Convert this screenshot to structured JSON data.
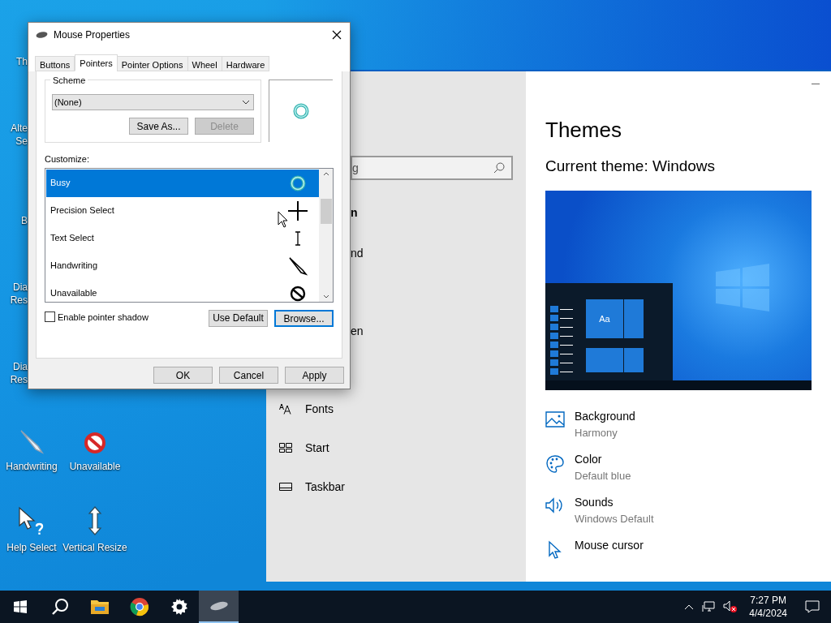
{
  "desktop": {
    "icons_partial": [
      {
        "lines": [
          "Th"
        ]
      },
      {
        "lines": [
          "Alte",
          "Se"
        ]
      },
      {
        "lines": [
          "B"
        ]
      },
      {
        "lines": [
          "Dia",
          "Res"
        ]
      },
      {
        "lines": [
          "Dia",
          "Res"
        ]
      }
    ],
    "icons": [
      {
        "label": "Handwriting",
        "kind": "pen"
      },
      {
        "label": "Unavailable",
        "kind": "no"
      },
      {
        "label": "Help Select",
        "kind": "help"
      },
      {
        "label": "Vertical Resize",
        "kind": "vresize"
      }
    ]
  },
  "settings_window": {
    "search": {
      "value": "g"
    },
    "nav": [
      {
        "label": "n",
        "kind": "header"
      },
      {
        "label": "nd",
        "kind": "partial"
      },
      {
        "label": "en",
        "kind": "partial"
      },
      {
        "label": "Fonts",
        "kind": "fonts"
      },
      {
        "label": "Start",
        "kind": "start"
      },
      {
        "label": "Taskbar",
        "kind": "taskbar"
      }
    ],
    "title": "Themes",
    "current_theme": "Current theme: Windows",
    "preview_tile": "Aa",
    "options": [
      {
        "title": "Background",
        "value": "Harmony",
        "kind": "picture"
      },
      {
        "title": "Color",
        "value": "Default blue",
        "kind": "palette"
      },
      {
        "title": "Sounds",
        "value": "Windows Default",
        "kind": "sound"
      },
      {
        "title": "Mouse cursor",
        "kind": "cursor"
      }
    ]
  },
  "dialog": {
    "title": "Mouse Properties",
    "tabs": [
      {
        "label": "Buttons",
        "selected": false
      },
      {
        "label": "Pointers",
        "selected": true
      },
      {
        "label": "Pointer Options",
        "selected": false
      },
      {
        "label": "Wheel",
        "selected": false
      },
      {
        "label": "Hardware",
        "selected": false
      }
    ],
    "scheme": {
      "label": "Scheme",
      "value": "(None)",
      "buttons": [
        {
          "label": "Save As...",
          "disabled": false
        },
        {
          "label": "Delete",
          "disabled": true
        }
      ]
    },
    "customize_label": "Customize:",
    "pointers": [
      {
        "name": "Busy",
        "kind": "busy",
        "selected": true
      },
      {
        "name": "Precision Select",
        "kind": "cross",
        "selected": false
      },
      {
        "name": "Text Select",
        "kind": "beam",
        "selected": false
      },
      {
        "name": "Handwriting",
        "kind": "pen",
        "selected": false
      },
      {
        "name": "Unavailable",
        "kind": "no",
        "selected": false
      }
    ],
    "shadow": {
      "label": "Enable pointer shadow",
      "checked": false
    },
    "use_default": "Use Default",
    "browse": "Browse...",
    "buttons": [
      "OK",
      "Cancel",
      "Apply"
    ]
  },
  "taskbar": {
    "apps": [
      {
        "kind": "start",
        "active": false
      },
      {
        "kind": "search",
        "active": false
      },
      {
        "kind": "folder",
        "active": false
      },
      {
        "kind": "browser",
        "active": false
      },
      {
        "kind": "gear",
        "active": false
      },
      {
        "kind": "mouse",
        "active": true
      }
    ],
    "time": "7:27 PM",
    "date": "4/4/2024"
  }
}
